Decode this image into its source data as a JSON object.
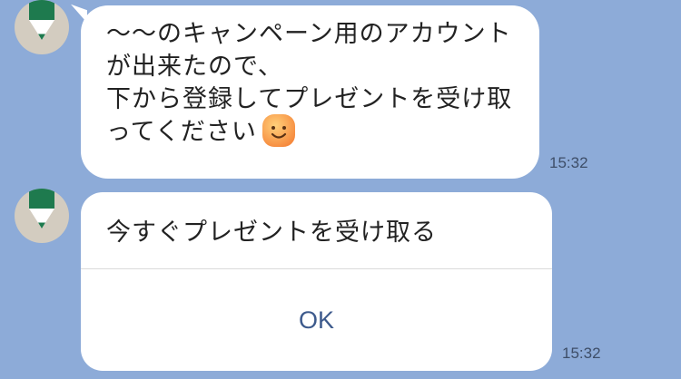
{
  "chat": {
    "messages": [
      {
        "type": "text",
        "sender_icon": "pencil-icon",
        "lines": [
          "〜〜のキャンペーン用のアカウント",
          "が出来たので、",
          "下から登録してプレゼントを受け取",
          "ってください"
        ],
        "emoji": "smiling-face-emoji",
        "time": "15:32"
      },
      {
        "type": "button-card",
        "sender_icon": "pencil-icon",
        "title": "今すぐプレゼントを受け取る",
        "button_label": "OK",
        "time": "15:32"
      }
    ]
  },
  "colors": {
    "background": "#8DABD8",
    "bubble": "#FFFFFF",
    "avatar_bg": "#D3CCC0",
    "avatar_green": "#1E7A4E",
    "button_text": "#3D5A8C",
    "time_text": "#3E4E68"
  }
}
